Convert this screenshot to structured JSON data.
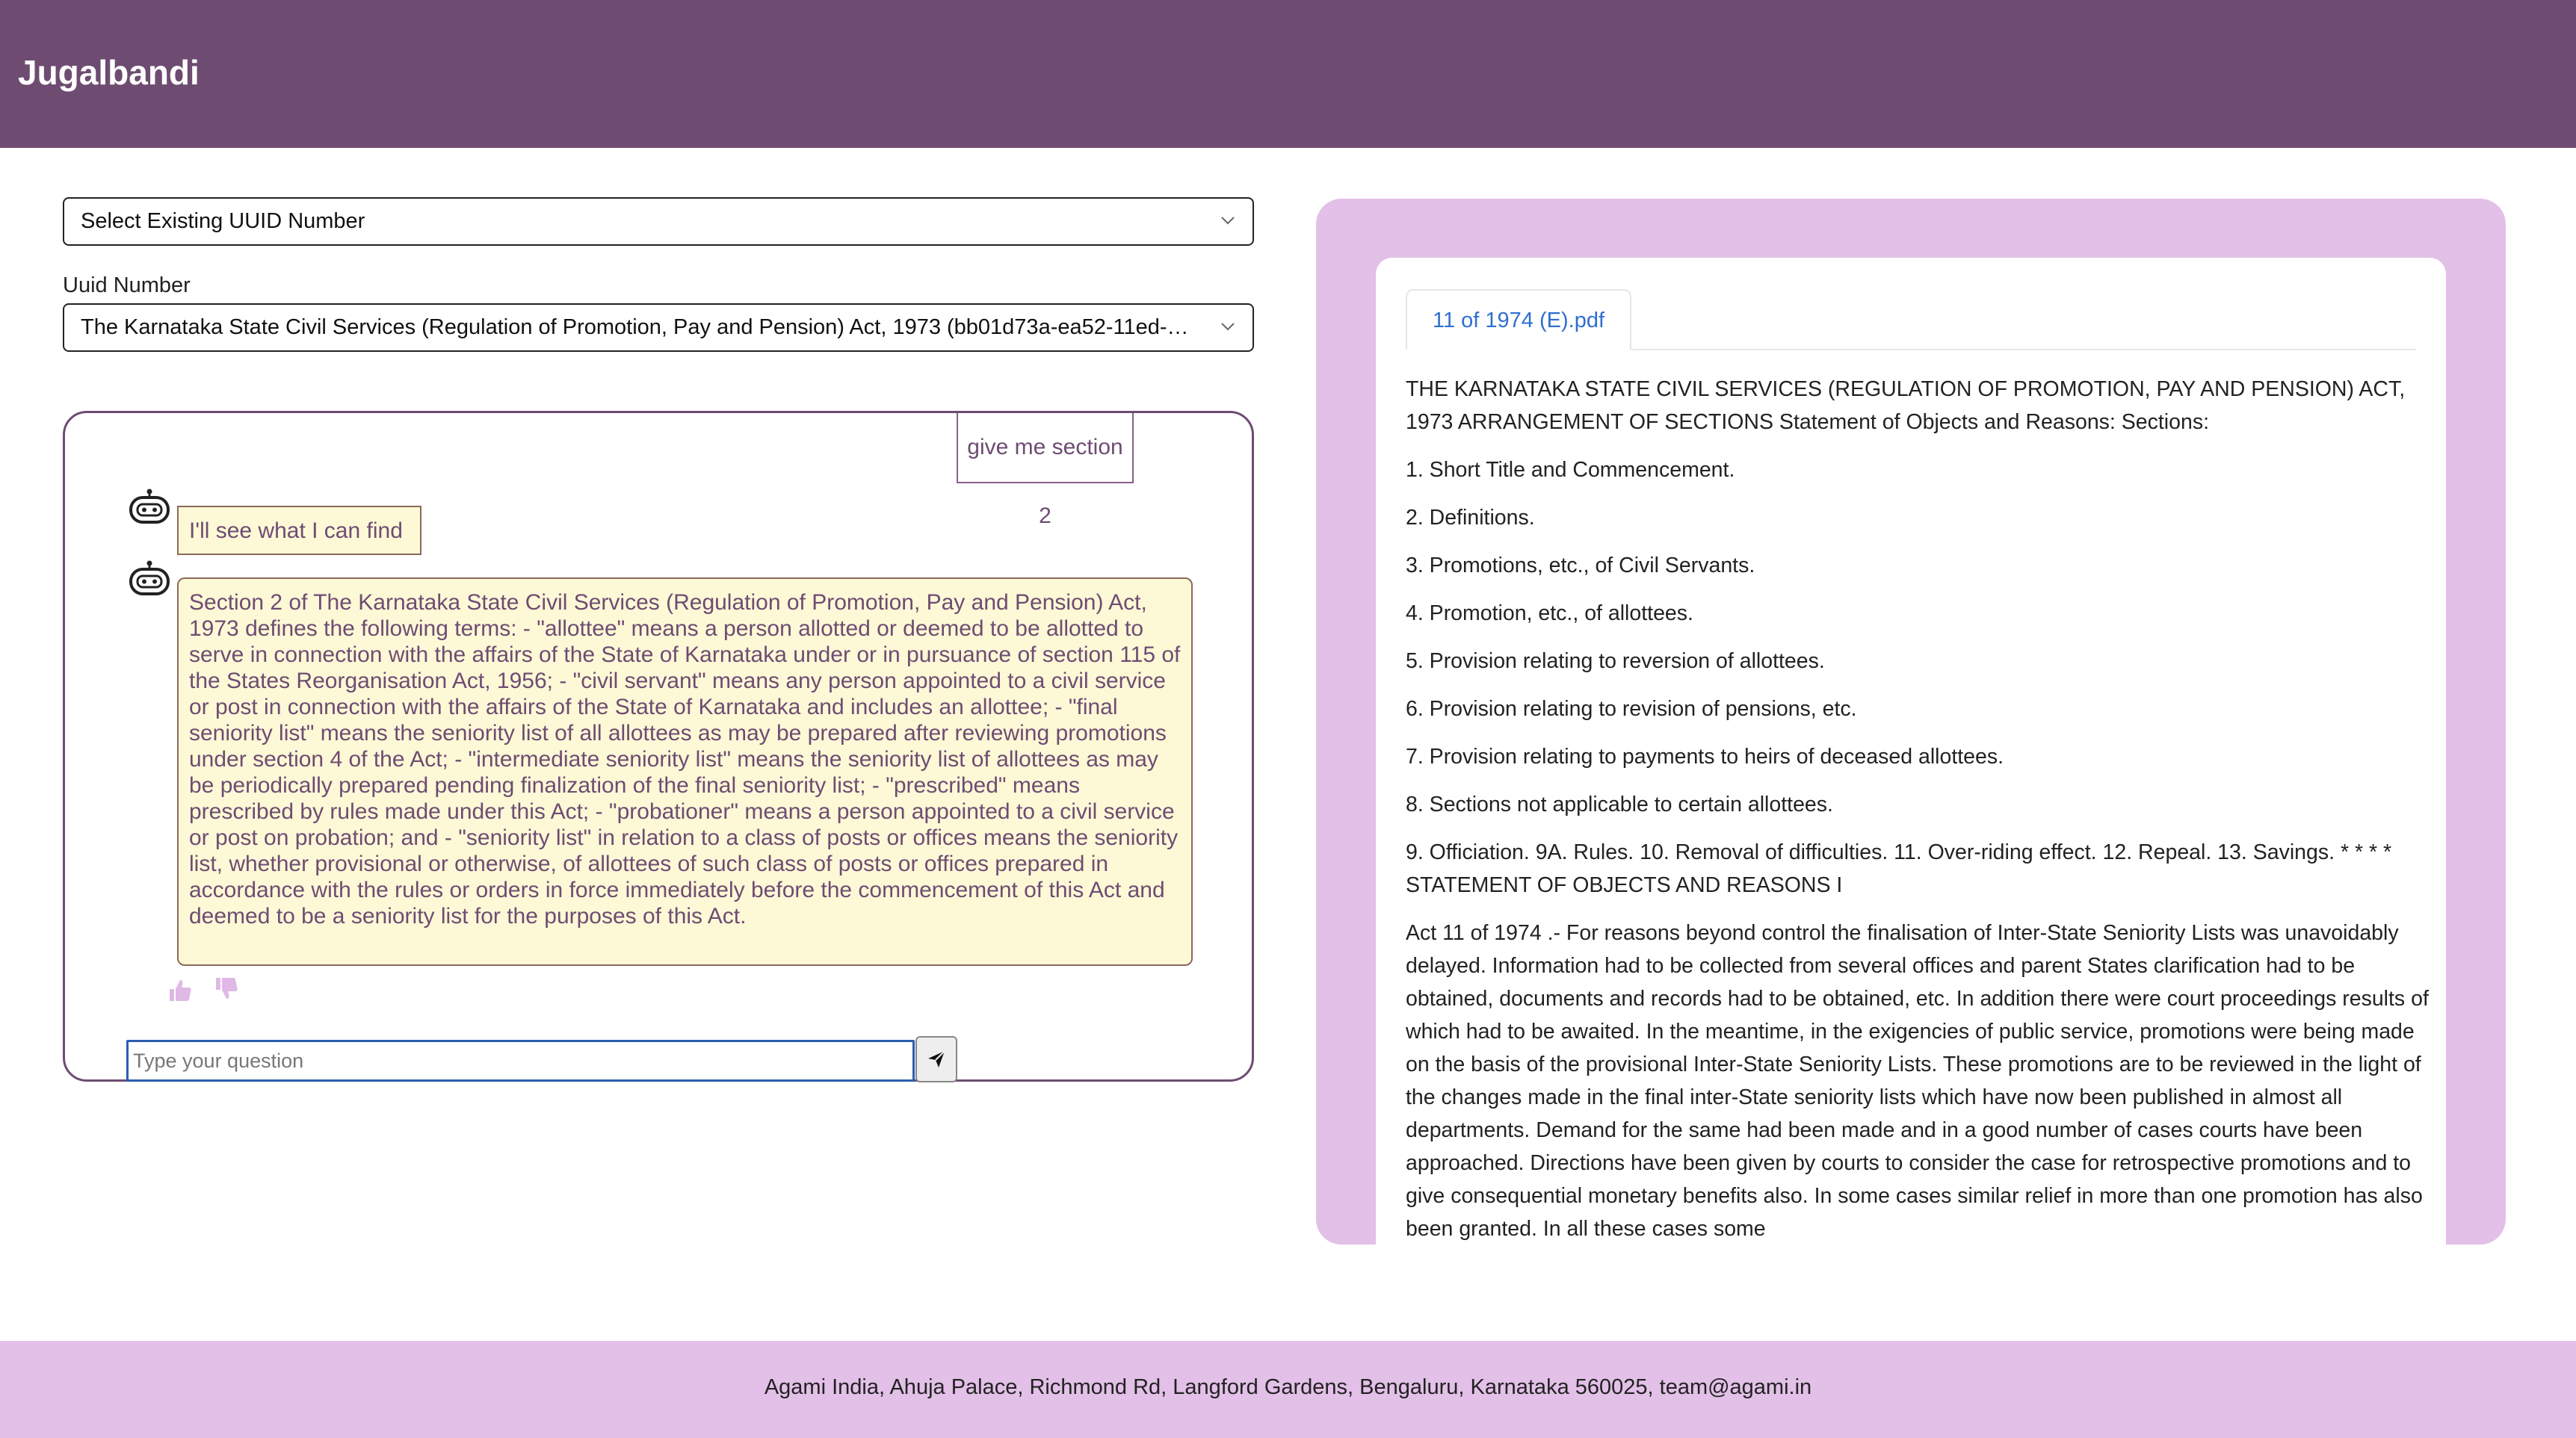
{
  "header": {
    "brand": "Jugalbandi"
  },
  "form": {
    "existing_uuid_select": "Select Existing UUID Number",
    "uuid_label": "Uuid Number",
    "uuid_select_value": "The Karnataka State Civil Services (Regulation of Promotion, Pay and Pension) Act, 1973 (bb01d73a-ea52-11ed-9b…"
  },
  "chat": {
    "user_message": "give me section 2",
    "bot_messages": [
      "I'll see what I can find",
      "Section 2 of The Karnataka State Civil Services (Regulation of Promotion, Pay and Pension) Act, 1973 defines the following terms: - \"allottee\" means a person allotted or deemed to be allotted to serve in connection with the affairs of the State of Karnataka under or in pursuance of section 115 of the States Reorganisation Act, 1956; - \"civil servant\" means any person appointed to a civil service or post in connection with the affairs of the State of Karnataka and includes an allottee; - \"final seniority list\" means the seniority list of all allottees as may be prepared after reviewing promotions under section 4 of the Act; - \"intermediate seniority list\" means the seniority list of allottees as may be periodically prepared pending finalization of the final seniority list; - \"prescribed\" means prescribed by rules made under this Act; - \"probationer\" means a person appointed to a civil service or post on probation; and - \"seniority list\" in relation to a class of posts or offices means the seniority list, whether provisional or otherwise, of allottees of such class of posts or offices prepared in accordance with the rules or orders in force immediately before the commencement of this Act and deemed to be a seniority list for the purposes of this Act."
    ],
    "input_placeholder": "Type your question",
    "input_value": "",
    "icons": {
      "bot": "robot-icon",
      "like": "thumbs-up-icon",
      "dislike": "thumbs-down-icon",
      "send": "send-icon"
    }
  },
  "document": {
    "tab_label": "11 of 1974 (E).pdf",
    "paragraphs": [
      "THE KARNATAKA STATE CIVIL SERVICES (REGULATION OF PROMOTION, PAY AND PENSION) ACT, 1973 ARRANGEMENT OF SECTIONS Statement of Objects and Reasons: Sections:",
      "1. Short Title and Commencement.",
      "2. Definitions.",
      "3. Promotions, etc., of Civil Servants.",
      "4. Promotion, etc., of allottees.",
      "5. Provision relating to reversion of allottees.",
      "6. Provision relating to revision of pensions, etc.",
      "7. Provision relating to payments to heirs of deceased allottees.",
      "8. Sections not applicable to certain allottees.",
      "9. Officiation. 9A. Rules. 10. Removal of difficulties. 11. Over-riding effect. 12. Repeal. 13. Savings. * * * * STATEMENT OF OBJECTS AND REASONS I",
      "Act 11 of 1974 .- For reasons beyond control the finalisation of Inter-State Seniority Lists was unavoidably delayed. Information had to be collected from several offices and parent States clarification had to be obtained, documents and records had to be obtained, etc. In addition there were court proceedings results of which had to be awaited. In the meantime, in the exigencies of public service, promotions were being made on the basis of the provisional Inter-State Seniority Lists. These promotions are to be reviewed in the light of the changes made in the final inter-State seniority lists which have now been published in almost all departments. Demand for the same had been made and in a good number of cases courts have been approached. Directions have been given by courts to consider the case for retrospective promotions and to give consequential monetary benefits also. In some cases similar relief in more than one promotion has also been granted. In all these cases some"
    ]
  },
  "footer": {
    "address": "Agami India, Ahuja Palace, Richmond Rd, Langford Gardens, Bengaluru, Karnataka 560025, team@agami.in"
  },
  "colors": {
    "header_bg": "#6e4c72",
    "panel_bg": "#e2c0e7",
    "bubble_bg": "#fdf8d6",
    "link": "#2f6fd0"
  }
}
